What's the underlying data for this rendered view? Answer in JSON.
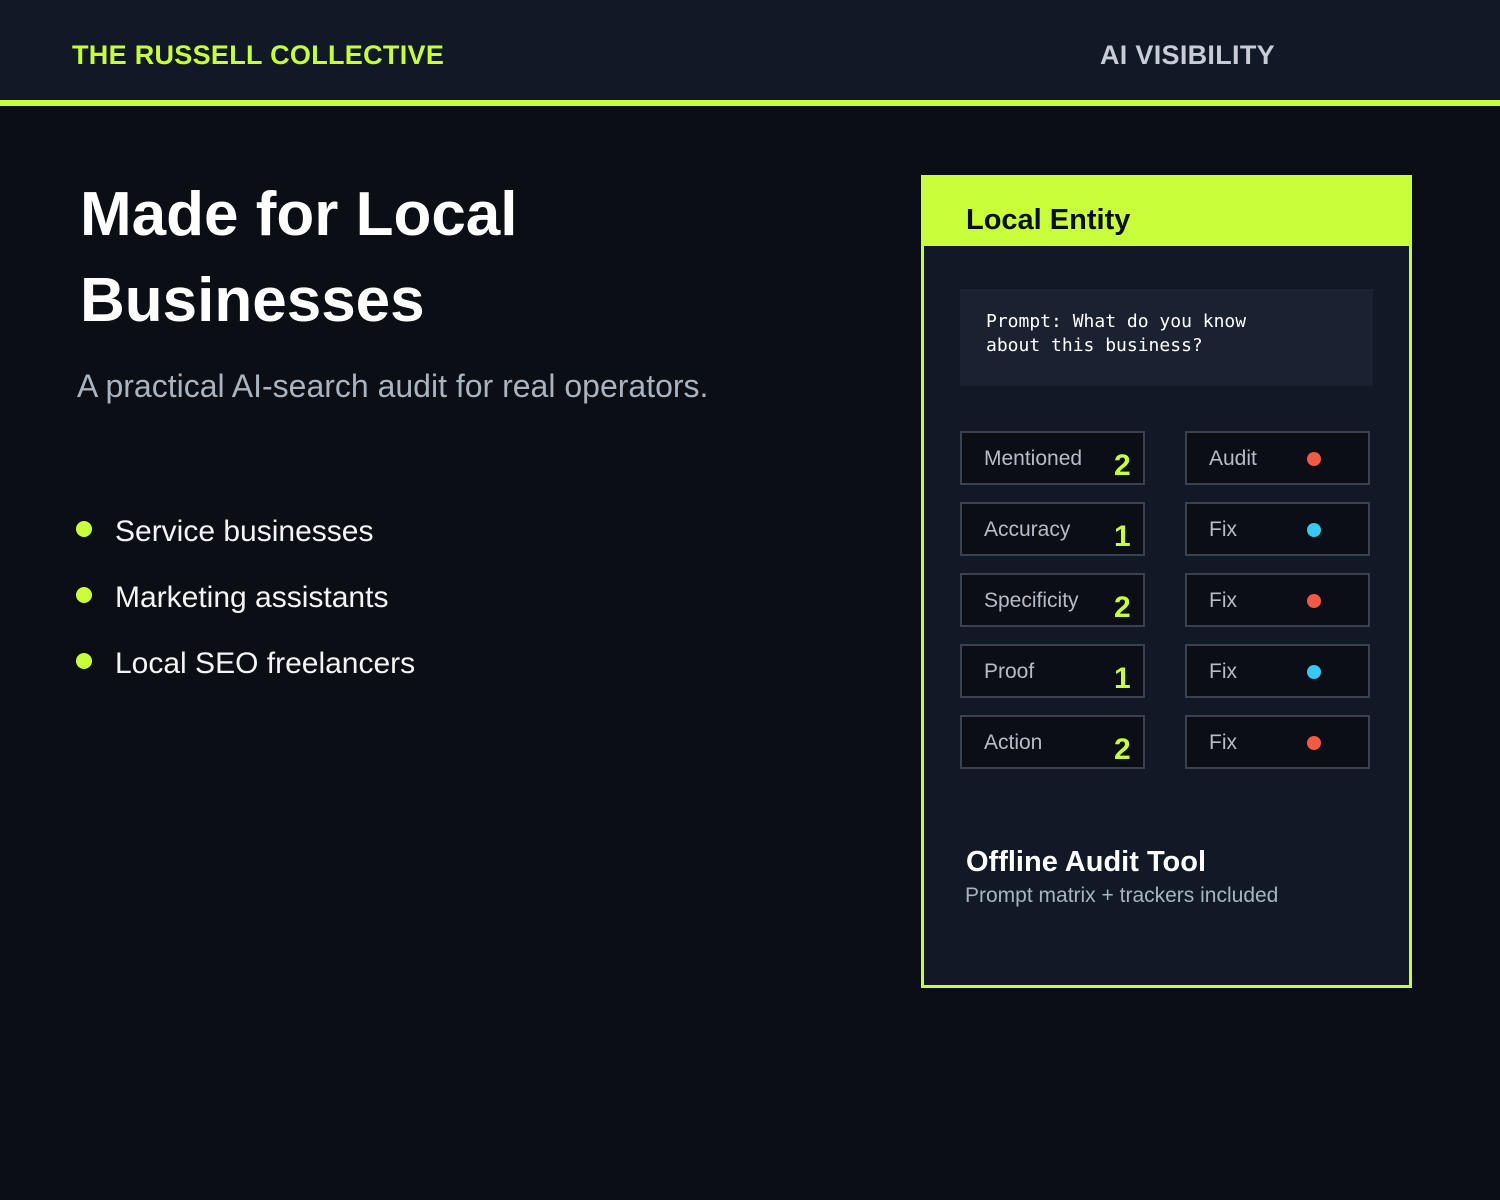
{
  "header": {
    "brand": "THE RUSSELL COLLECTIVE",
    "nav_label": "AI VISIBILITY"
  },
  "hero": {
    "title": "Made for Local Businesses",
    "subtitle": "A practical AI-search audit for real operators."
  },
  "audience": [
    "Service businesses",
    "Marketing assistants",
    "Local SEO freelancers"
  ],
  "card": {
    "title": "Local Entity",
    "prompt": "Prompt: What do you know about this business?",
    "rows": [
      {
        "metric": "Mentioned",
        "score": "2",
        "action": "Audit",
        "status_color": "#f25a46"
      },
      {
        "metric": "Accuracy",
        "score": "1",
        "action": "Fix",
        "status_color": "#38c8f4"
      },
      {
        "metric": "Specificity",
        "score": "2",
        "action": "Fix",
        "status_color": "#f25a46"
      },
      {
        "metric": "Proof",
        "score": "1",
        "action": "Fix",
        "status_color": "#38c8f4"
      },
      {
        "metric": "Action",
        "score": "2",
        "action": "Fix",
        "status_color": "#f25a46"
      }
    ],
    "footer_title": "Offline Audit Tool",
    "footer_subtitle": "Prompt matrix + trackers included"
  },
  "colors": {
    "accent": "#c8ff3a",
    "background": "#0b0e14",
    "panel": "#111826"
  }
}
